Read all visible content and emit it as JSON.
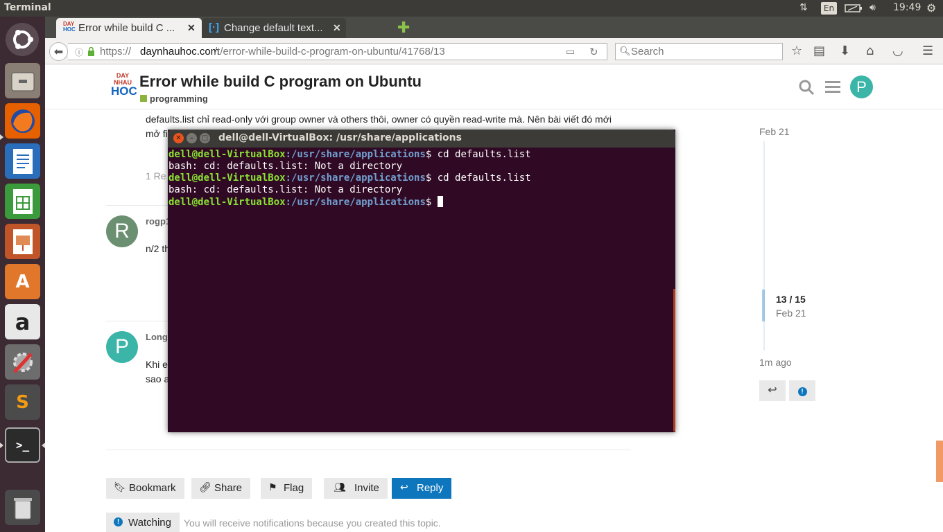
{
  "panel": {
    "app_name": "Terminal",
    "keyboard": "En",
    "time": "19:49"
  },
  "browser": {
    "tabs": [
      {
        "title": "Error while build C ...",
        "active": true
      },
      {
        "title": "Change default text...",
        "active": false
      }
    ],
    "tab_close_glyph": "✕",
    "url_scheme": "https://",
    "url_host": "daynhauhoc.com",
    "url_path": "/t/error-while-build-c-program-on-ubuntu/41768/13",
    "search_placeholder": "Search"
  },
  "page": {
    "logo": {
      "line1": "DAY",
      "line2": "NHAU",
      "line3": "HOC"
    },
    "title": "Error while build C program on Ubuntu",
    "category": "programming",
    "post_line1": "defaults.list chỉ read-only với group owner và others thôi, owner có quyền read-write mà. Nên bài viết đó mới",
    "post_line2": "mở fi",
    "replies_stub": "1 Re",
    "user1": {
      "initial": "R",
      "name": "rogp1",
      "text": "n/2 th",
      "color": "#6b8f71"
    },
    "user2": {
      "initial": "P",
      "name": "Long",
      "line1": "Khi e",
      "line2": "sao a",
      "color": "#3ab5a7"
    },
    "timeline": {
      "top_date": "Feb 21",
      "progress": "13 / 15",
      "progress_date": "Feb 21",
      "bottom_date": "1m ago"
    },
    "footer_buttons": [
      {
        "label": "Bookmark",
        "icon": "bookmark-icon"
      },
      {
        "label": "Share",
        "icon": "link-icon"
      },
      {
        "label": "Flag",
        "icon": "flag-icon"
      },
      {
        "label": "Invite",
        "icon": "users-icon"
      },
      {
        "label": "Reply",
        "icon": "reply-icon"
      }
    ],
    "watching_label": "Watching",
    "notification_text": "You will receive notifications because you created this topic."
  },
  "terminal": {
    "title": "dell@dell-VirtualBox: /usr/share/applications",
    "prompt_user": "dell@dell-VirtualBox",
    "prompt_path": ":/usr/share/applications",
    "prompt_symbol": "$ ",
    "lines": [
      {
        "type": "prompt",
        "cmd": "cd defaults.list"
      },
      {
        "type": "output",
        "text": "bash: cd: defaults.list: Not a directory"
      },
      {
        "type": "prompt",
        "cmd": "cd defaults.list"
      },
      {
        "type": "output",
        "text": "bash: cd: defaults.list: Not a directory"
      },
      {
        "type": "prompt",
        "cmd": ""
      }
    ]
  },
  "colors": {
    "terminal_bg": "#300a24",
    "prompt_user": "#8ae234",
    "prompt_path": "#729fcf",
    "accent": "#0e76bd",
    "category": "#8cb33d"
  }
}
